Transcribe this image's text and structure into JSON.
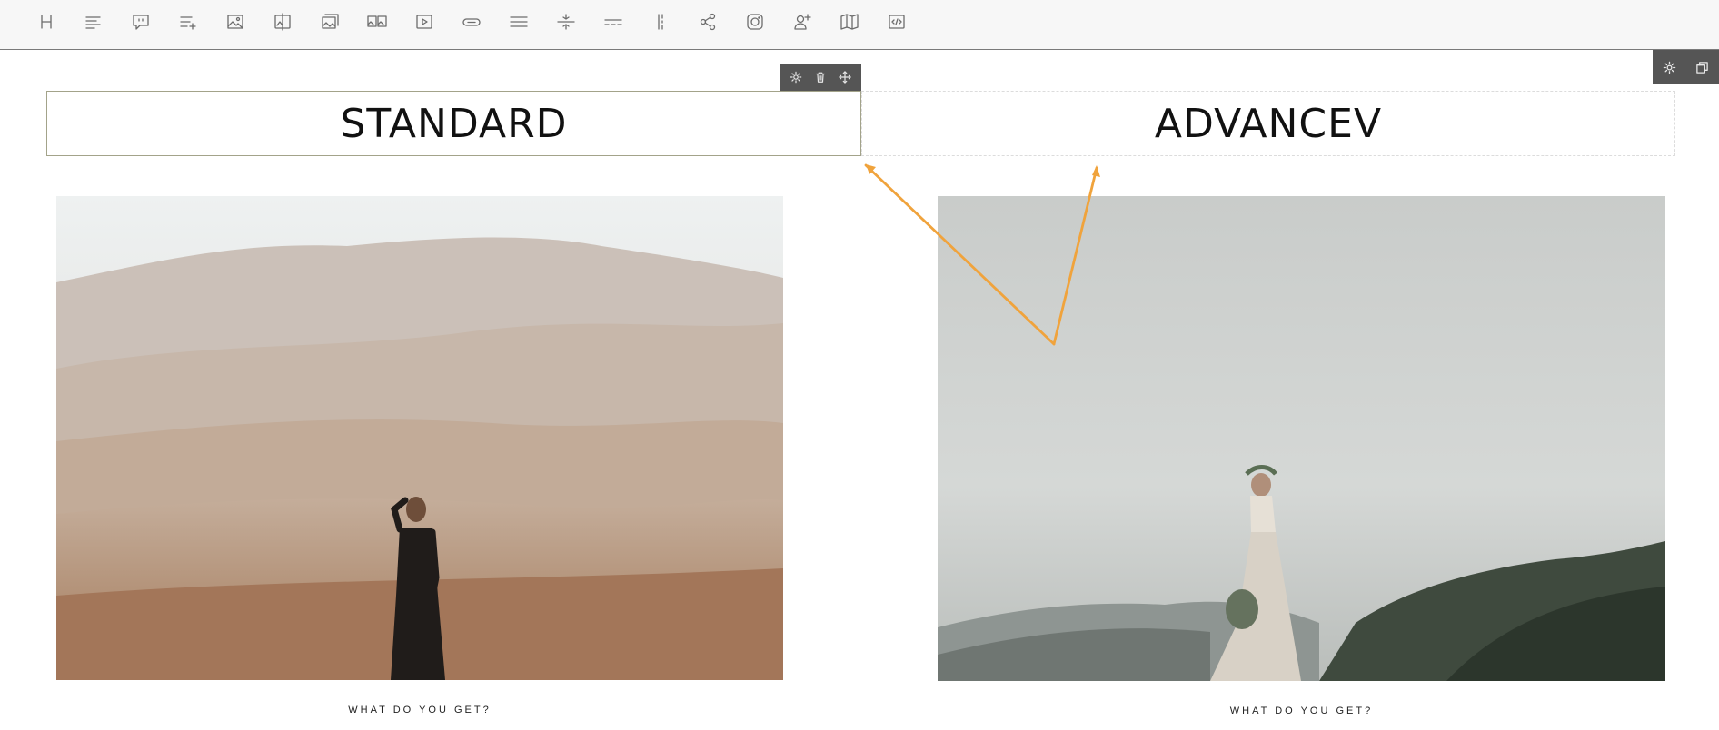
{
  "toolbar": {
    "tools": [
      {
        "icon": "heading-icon"
      },
      {
        "icon": "paragraph-icon"
      },
      {
        "icon": "quote-icon"
      },
      {
        "icon": "list-add-icon"
      },
      {
        "icon": "image-icon"
      },
      {
        "icon": "image-compare-icon"
      },
      {
        "icon": "image-gallery-icon"
      },
      {
        "icon": "image-grid-icon"
      },
      {
        "icon": "video-icon"
      },
      {
        "icon": "button-icon"
      },
      {
        "icon": "divider-lines-icon"
      },
      {
        "icon": "spacer-icon"
      },
      {
        "icon": "separator-dashed-icon"
      },
      {
        "icon": "column-divider-icon"
      },
      {
        "icon": "share-icon"
      },
      {
        "icon": "instagram-icon"
      },
      {
        "icon": "add-person-icon"
      },
      {
        "icon": "map-icon"
      },
      {
        "icon": "code-icon"
      }
    ]
  },
  "block_controls": [
    "gear-icon",
    "trash-icon",
    "move-icon"
  ],
  "row_controls": [
    "gear-icon",
    "duplicate-icon"
  ],
  "columns": [
    {
      "heading": "STANDARD",
      "caption": "WHAT DO YOU GET?",
      "image": "woman in black dress in misty desert dunes"
    },
    {
      "heading": "ADVANCEV",
      "caption": "WHAT DO YOU GET?",
      "image": "bride in lace gown on foggy mountain"
    }
  ],
  "colors": {
    "annotation_arrow": "#f0a33c",
    "control_bar": "#555555",
    "active_border": "#a3a38a"
  }
}
